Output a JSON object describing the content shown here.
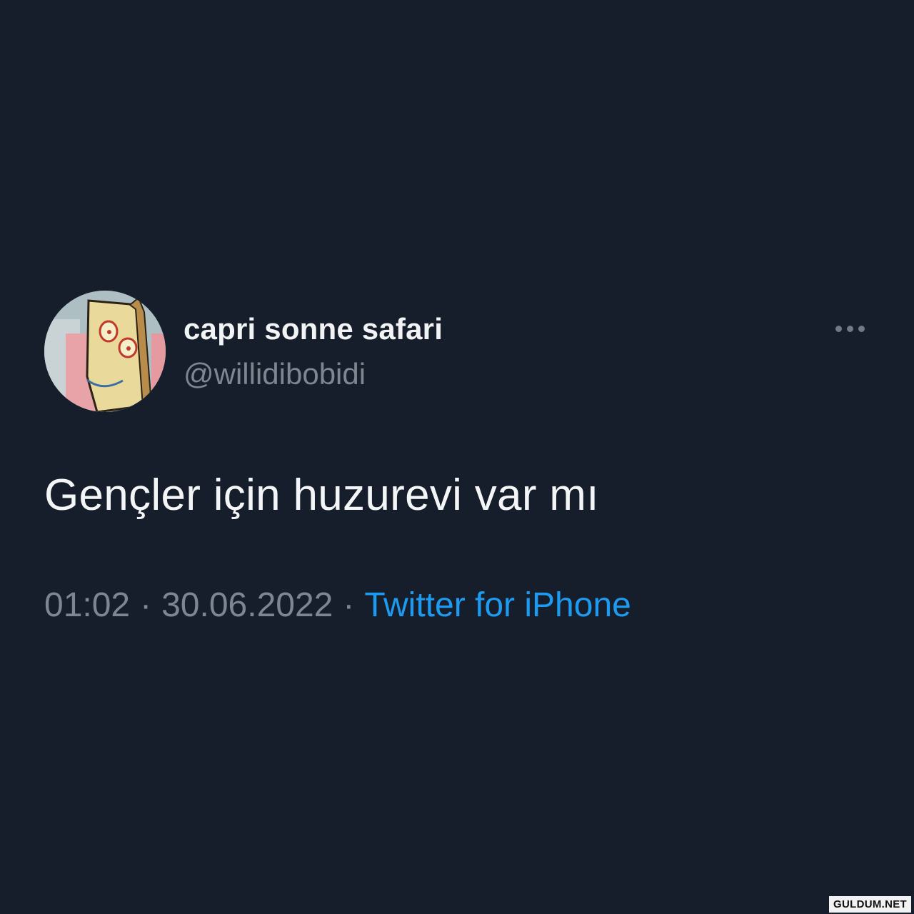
{
  "tweet": {
    "display_name": "capri sonne safari",
    "handle": "@willidibobidi",
    "text": "Gençler için huzurevi var mı",
    "time": "01:02",
    "date": "30.06.2022",
    "separator": "·",
    "source": "Twitter for iPhone"
  },
  "icons": {
    "more": "more-horizontal-icon",
    "avatar": "cartoon-plank-face-avatar"
  },
  "colors": {
    "background": "#161e2b",
    "text_primary": "#f4f5f6",
    "text_secondary": "#7d8791",
    "link": "#1d9bf0"
  },
  "watermark": "GULDUM.NET"
}
